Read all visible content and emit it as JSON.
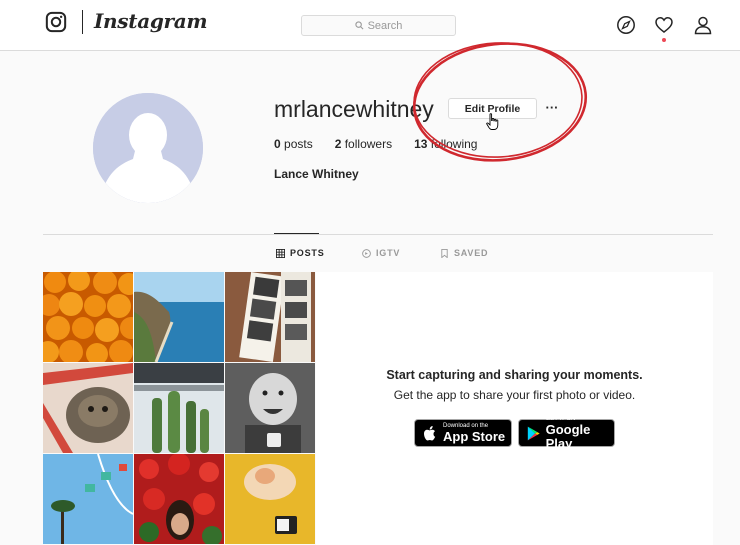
{
  "nav": {
    "logo_icon": "instagram-camera-icon",
    "wordmark": "Instagram",
    "search_placeholder": "Search",
    "icons": [
      "compass-icon",
      "heart-icon",
      "person-icon"
    ]
  },
  "profile": {
    "username": "mrlancewhitney",
    "edit_label": "Edit Profile",
    "more_label": "···",
    "posts_count": "0",
    "posts_label": " posts",
    "followers_count": "2",
    "followers_label": " followers",
    "following_count": "13",
    "following_label": " following",
    "full_name": "Lance Whitney"
  },
  "tabs": [
    {
      "label": "POSTS",
      "icon": "grid-icon",
      "active": true
    },
    {
      "label": "IGTV",
      "icon": "igtv-icon",
      "active": false
    },
    {
      "label": "SAVED",
      "icon": "bookmark-icon",
      "active": false
    }
  ],
  "promo": {
    "title": "Start capturing and sharing your moments.",
    "subtitle": "Get the app to share your first photo or video.",
    "appstore_small": "Download on the",
    "appstore_big": "App Store",
    "googleplay_small": "GET IT ON",
    "googleplay_big": "Google Play"
  },
  "colors": {
    "annotation_circle": "#d0282e",
    "border": "#dbdbdb",
    "notification_dot": "#ed4956"
  }
}
